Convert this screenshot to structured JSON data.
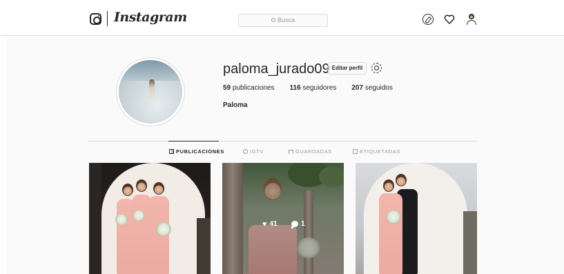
{
  "navbar": {
    "logo_icon": "instagram-glyph-icon",
    "wordmark": "Instagram",
    "search_placeholder": "Busca",
    "icons": [
      "compass-icon",
      "heart-icon",
      "person-icon"
    ]
  },
  "profile": {
    "username": "paloma_jurado09",
    "edit_label": "Editar perfil",
    "posts_count": "59",
    "posts_label": "publicaciones",
    "followers_count": "116",
    "followers_label": "seguidores",
    "following_count": "207",
    "following_label": "seguidos",
    "full_name": "Paloma"
  },
  "tabs": [
    {
      "label": "PUBLICACIONES",
      "icon": "grid-icon",
      "active": true
    },
    {
      "label": "IGTV",
      "icon": "igtv-icon",
      "active": false
    },
    {
      "label": "GUARDADAS",
      "icon": "bookmark-icon",
      "active": false
    },
    {
      "label": "ETIQUETADAS",
      "icon": "tag-icon",
      "active": false
    }
  ],
  "posts": [
    {
      "hover": false
    },
    {
      "hover": true,
      "likes": "41",
      "comments": "1"
    },
    {
      "hover": false
    }
  ],
  "colors": {
    "text": "#262626",
    "muted": "#999999",
    "border": "#dbdbdb",
    "background": "#fafafa"
  }
}
